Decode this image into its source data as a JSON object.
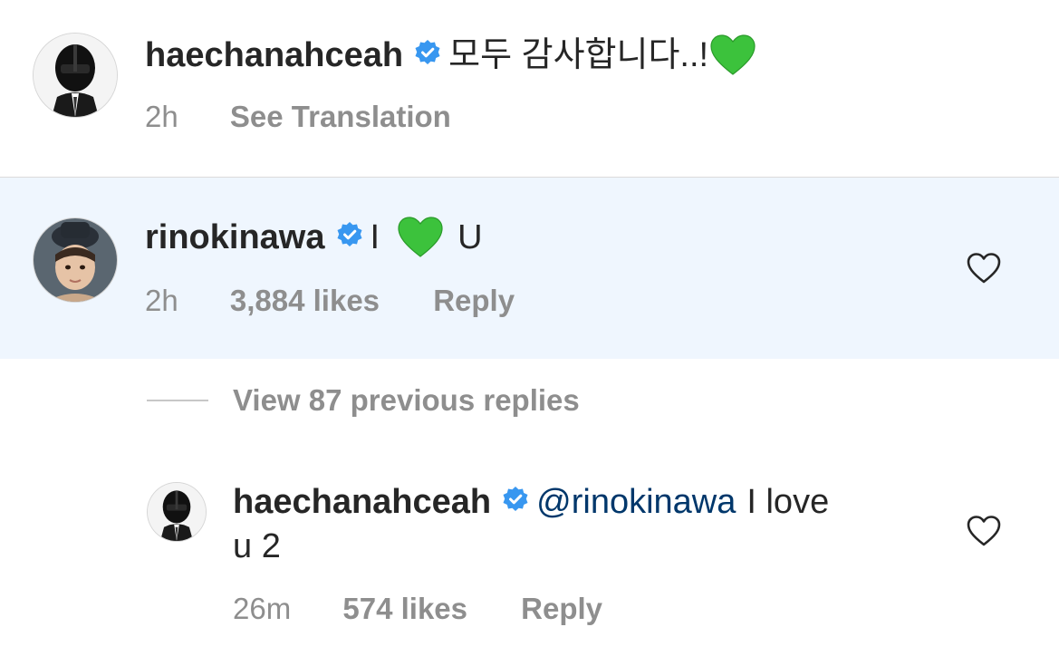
{
  "comments": [
    {
      "username": "haechanahceah",
      "verified": true,
      "text": "모두 감사합니다..!",
      "emoji": "green-heart",
      "time": "2h",
      "action": "See Translation"
    },
    {
      "username": "rinokinawa",
      "verified": true,
      "text_before": "I",
      "emoji": "green-heart",
      "text_after": "U",
      "time": "2h",
      "likes": "3,884 likes",
      "action": "Reply"
    }
  ],
  "view_replies": "View 87 previous replies",
  "reply": {
    "username": "haechanahceah",
    "verified": true,
    "mention": "@rinokinawa",
    "text_line1": "I love",
    "text_line2": "u 2",
    "time": "26m",
    "likes": "574 likes",
    "action": "Reply"
  },
  "colors": {
    "verified_badge": "#3897f0",
    "mention": "#00376b",
    "highlight_bg": "#eff6fe",
    "green_heart": "#3cc23c",
    "meta_text": "#8e8e8e"
  }
}
